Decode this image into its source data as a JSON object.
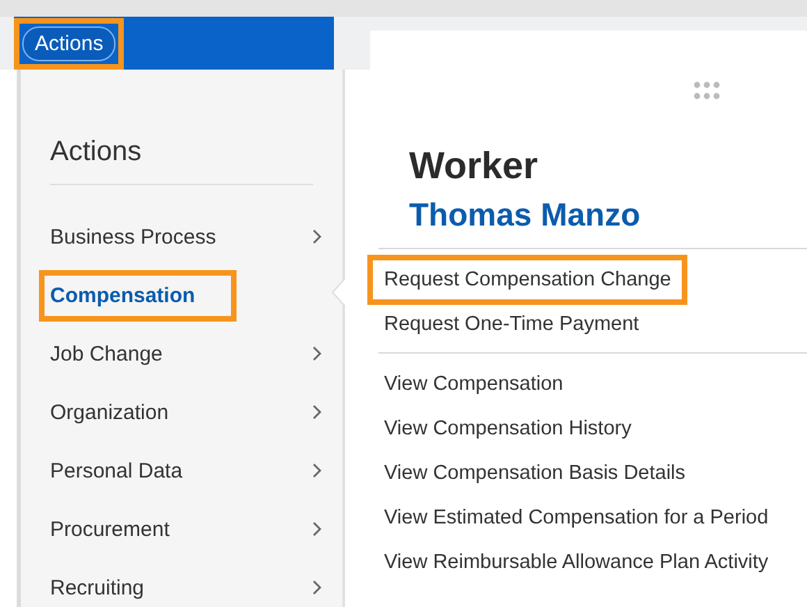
{
  "header": {
    "actions_button": {
      "label": "Actions",
      "highlighted": true
    }
  },
  "menu": {
    "title": "Actions",
    "items": [
      {
        "label": "Business Process",
        "selected": false,
        "highlighted": false,
        "has_submenu": true
      },
      {
        "label": "Compensation",
        "selected": true,
        "highlighted": true,
        "has_submenu": false
      },
      {
        "label": "Job Change",
        "selected": false,
        "highlighted": false,
        "has_submenu": true
      },
      {
        "label": "Organization",
        "selected": false,
        "highlighted": false,
        "has_submenu": true
      },
      {
        "label": "Personal Data",
        "selected": false,
        "highlighted": false,
        "has_submenu": true
      },
      {
        "label": "Procurement",
        "selected": false,
        "highlighted": false,
        "has_submenu": true
      },
      {
        "label": "Recruiting",
        "selected": false,
        "highlighted": false,
        "has_submenu": true
      }
    ]
  },
  "worker": {
    "label": "Worker",
    "name": "Thomas Manzo"
  },
  "submenu": {
    "groups": [
      [
        {
          "label": "Request Compensation Change",
          "highlighted": true
        },
        {
          "label": "Request One-Time Payment",
          "highlighted": false
        }
      ],
      [
        {
          "label": "View Compensation",
          "highlighted": false
        },
        {
          "label": "View Compensation History",
          "highlighted": false
        },
        {
          "label": "View Compensation Basis Details",
          "highlighted": false
        },
        {
          "label": "View Estimated Compensation for a Period",
          "highlighted": false
        },
        {
          "label": "View Reimbursable Allowance Plan Activity",
          "highlighted": false
        }
      ]
    ]
  }
}
